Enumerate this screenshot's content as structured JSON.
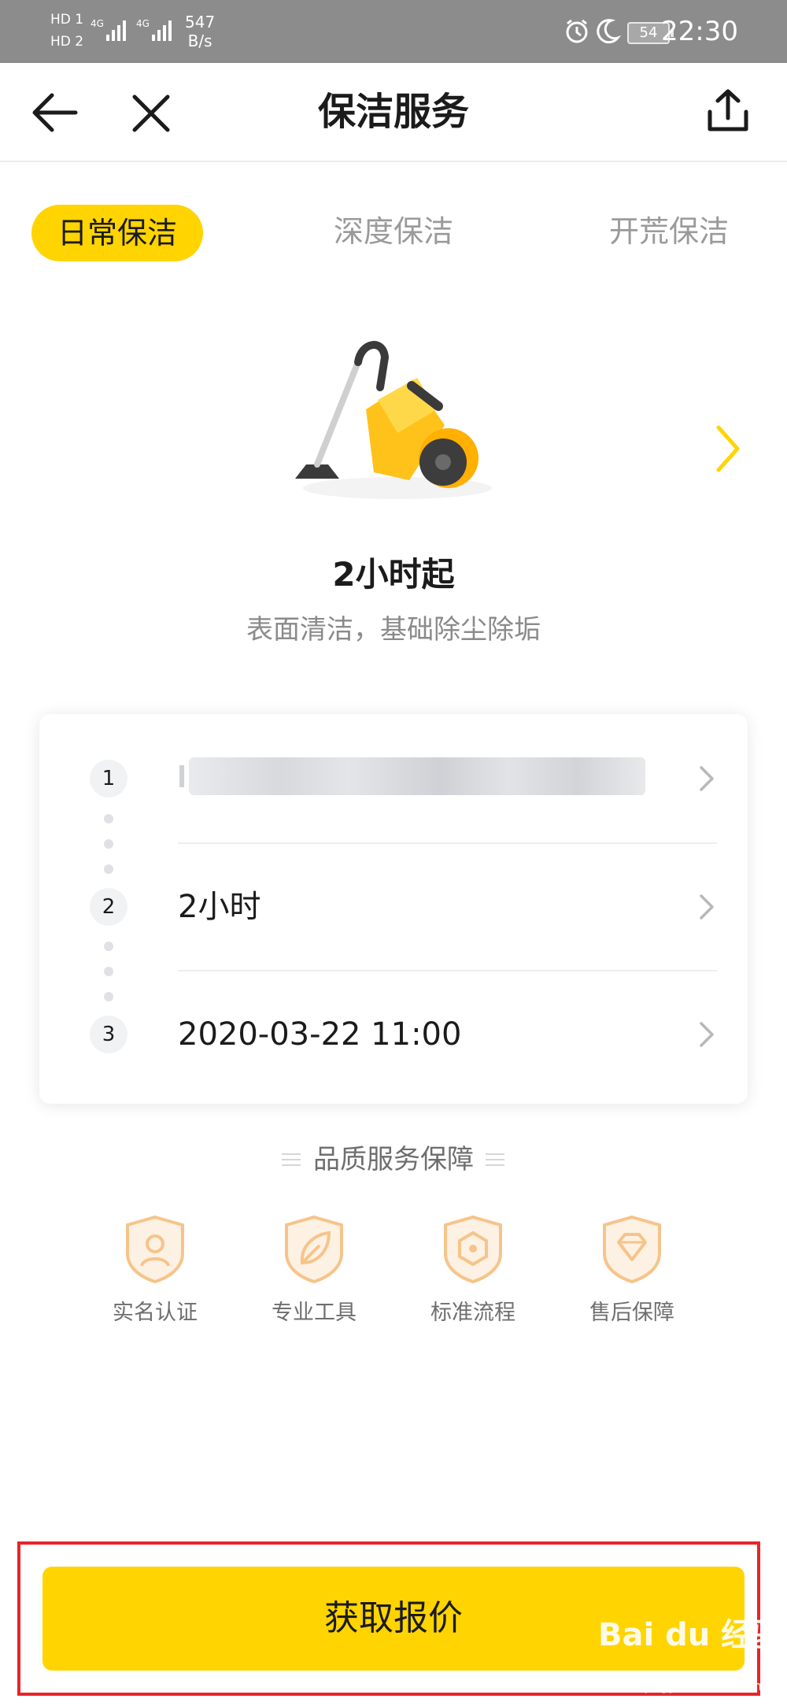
{
  "status_bar": {
    "sim1": "HD 1",
    "sim2": "HD 2",
    "net_speed": "547",
    "net_unit": "B/s",
    "net_type": "4G",
    "battery": "54",
    "time": "22:30"
  },
  "nav": {
    "title": "保洁服务"
  },
  "tabs": [
    {
      "label": "日常保洁",
      "active": true
    },
    {
      "label": "深度保洁",
      "active": false
    },
    {
      "label": "开荒保洁",
      "active": false
    }
  ],
  "service": {
    "headline": "2小时起",
    "description": "表面清洁，基础除尘除垢"
  },
  "steps": [
    {
      "num": "1",
      "value": ""
    },
    {
      "num": "2",
      "value": "2小时"
    },
    {
      "num": "3",
      "value": "2020-03-22 11:00"
    }
  ],
  "quality": {
    "title": "品质服务保障",
    "items": [
      {
        "label": "实名认证",
        "icon": "id-shield-icon"
      },
      {
        "label": "专业工具",
        "icon": "leaf-shield-icon"
      },
      {
        "label": "标准流程",
        "icon": "process-shield-icon"
      },
      {
        "label": "售后保障",
        "icon": "diamond-shield-icon"
      }
    ]
  },
  "cta": {
    "label": "获取报价"
  },
  "watermark": {
    "text": "Bai du 经验",
    "sub": "jingyan.baidu.com"
  },
  "colors": {
    "accent": "#ffd400",
    "highlight_frame": "#e8242a",
    "badge": "#f6c48a"
  }
}
